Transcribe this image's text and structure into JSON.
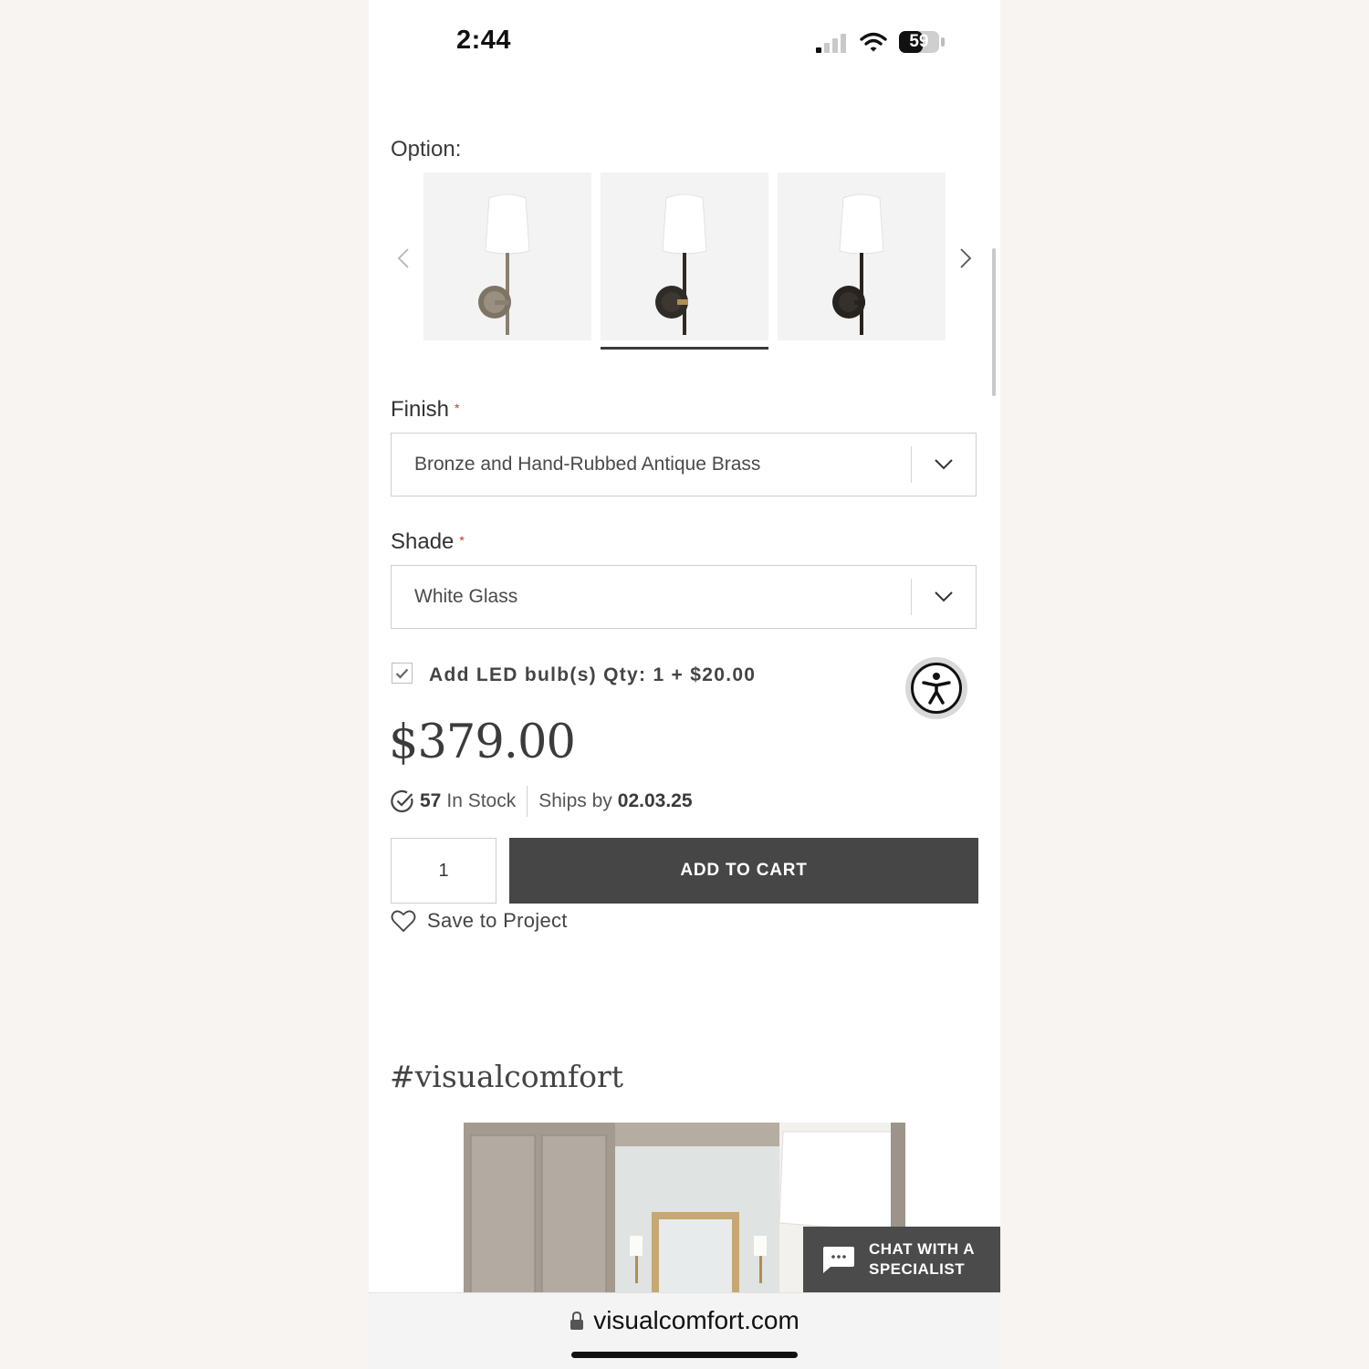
{
  "status_bar": {
    "time": "2:44",
    "battery": "59"
  },
  "options": {
    "label": "Option:",
    "thumbnails": [
      {
        "name": "Antique Nickel sconce"
      },
      {
        "name": "Bronze and Hand-Rubbed Antique Brass sconce"
      },
      {
        "name": "Bronze sconce"
      }
    ],
    "selected_index": 1
  },
  "finish": {
    "label": "Finish",
    "required_mark": "*",
    "value": "Bronze and Hand-Rubbed Antique Brass"
  },
  "shade": {
    "label": "Shade",
    "required_mark": "*",
    "value": "White Glass"
  },
  "led_addon": {
    "checked": true,
    "label": "Add LED bulb(s) Qty: 1 + $20.00"
  },
  "price": "$379.00",
  "stock": {
    "count": "57",
    "label": "In Stock",
    "ships_label": "Ships by",
    "ships_date": "02.03.25"
  },
  "cart": {
    "quantity": "1",
    "button_label": "ADD TO CART"
  },
  "save_to_project": "Save to Project",
  "hashtag": "#visualcomfort",
  "chat": {
    "line1": "CHAT WITH A",
    "line2": "SPECIALIST"
  },
  "url_bar": {
    "domain": "visualcomfort.com"
  },
  "colors": {
    "button_dark": "#464646",
    "required_red": "#c0392b",
    "page_bg": "#f7f4f1"
  }
}
